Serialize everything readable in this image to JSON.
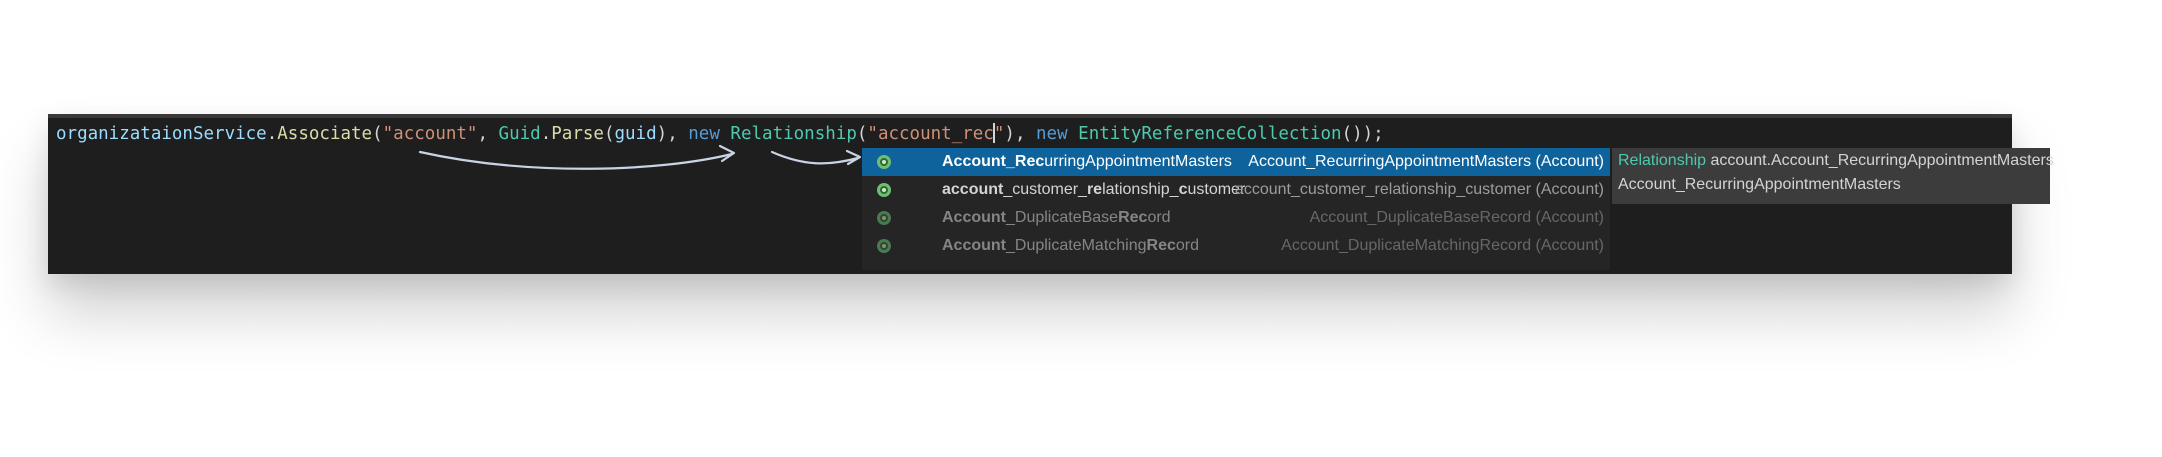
{
  "editor": {
    "code": {
      "receiver": "organizataionService",
      "dot1": ".",
      "method": "Associate",
      "open1": "(",
      "arg1": "\"account\"",
      "comma1": ", ",
      "guid_type": "Guid",
      "dot2": ".",
      "parse_method": "Parse",
      "open2": "(",
      "guid_arg": "guid",
      "close2": ")",
      "comma2": ", ",
      "new1": "new",
      "space1": " ",
      "relationship_type": "Relationship",
      "open3": "(",
      "string_before_caret": "\"account_rec",
      "string_after_caret": "\"",
      "close3": ")",
      "comma3": ", ",
      "new2": "new",
      "space2": " ",
      "collection_type": "EntityReferenceCollection",
      "tail": "());"
    },
    "colors": {
      "background": "#1e1e1e",
      "identifier": "#9cdcfe",
      "method": "#dcdcaa",
      "type": "#4ec9b0",
      "string": "#ce9178",
      "keyword": "#569cd6",
      "selection": "#0e639c"
    }
  },
  "completion": {
    "items": [
      {
        "icon": "relationship-icon",
        "label_bold_1": "Account_Rec",
        "label_rest_1": "urringAppointmentMasters",
        "label_bold_2": "",
        "label_rest_2": "",
        "label_bold_3": "",
        "label_rest_3": "",
        "description": "Account_RecurringAppointmentMasters (Account)",
        "selected": true
      },
      {
        "icon": "relationship-icon",
        "label_bold_1": "account",
        "label_rest_1": "_customer_",
        "label_bold_2": "re",
        "label_rest_2": "lationship_",
        "label_bold_3": "c",
        "label_rest_3": "ustomer",
        "description": "account_customer_relationship_customer (Account)",
        "selected": false
      },
      {
        "icon": "relationship-icon",
        "label_bold_1": "Account",
        "label_rest_1": "_DuplicateBase",
        "label_bold_2": "Rec",
        "label_rest_2": "ord",
        "label_bold_3": "",
        "label_rest_3": "",
        "description": "Account_DuplicateBaseRecord (Account)",
        "selected": false
      },
      {
        "icon": "relationship-icon",
        "label_bold_1": "Account",
        "label_rest_1": "_DuplicateMatching",
        "label_bold_2": "Rec",
        "label_rest_2": "ord",
        "label_bold_3": "",
        "label_rest_3": "",
        "description": "Account_DuplicateMatchingRecord (Account)",
        "selected": false
      }
    ],
    "detail": {
      "type_word": "Relationship",
      "signature": " account.Account_RecurringAppointmentMasters",
      "summary": "Account_RecurringAppointmentMasters"
    }
  }
}
